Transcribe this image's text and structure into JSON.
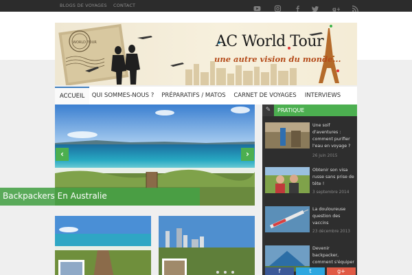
{
  "topbar": {
    "links": [
      "BLOGS DE VOYAGES",
      "CONTACT"
    ],
    "social_icons": [
      "youtube-icon",
      "instagram-icon",
      "facebook-icon",
      "twitter-icon",
      "google-plus-icon",
      "rss-icon"
    ]
  },
  "header": {
    "title": "AC World Tour",
    "subtitle": "une autre vision du monde...",
    "stamp_text": "WORLD TOUR"
  },
  "nav": {
    "items": [
      "ACCUEIL",
      "QUI SOMMES-NOUS ?",
      "PRÉPARATIFS / MATOS",
      "CARNET DE VOYAGES",
      "INTERVIEWS"
    ]
  },
  "slider": {
    "caption": "Backpackers En Australie",
    "prev_glyph": "‹",
    "next_glyph": "›"
  },
  "sidebar": {
    "title": "PRATIQUE",
    "pin_glyph": "✎",
    "posts": [
      {
        "title": "Une soif d'aventures : comment purifier l'eau en voyage ?",
        "date": "26 juin 2015"
      },
      {
        "title": "Obtenir son visa russe sans prise de tête !",
        "date": "3 septembre 2014"
      },
      {
        "title": "La douloureuse question des vaccins",
        "date": "23 décembre 2013"
      },
      {
        "title": "Devenir backpacker, comment s'équiper",
        "date": ""
      }
    ]
  },
  "share": {
    "facebook": "f",
    "twitter": "t",
    "google": "g+"
  },
  "colors": {
    "accent_green": "#4caf50",
    "nav_active": "#3f7fbf",
    "topbar_bg": "#2c2c2c",
    "sidebar_bg": "#2e2e2e"
  }
}
